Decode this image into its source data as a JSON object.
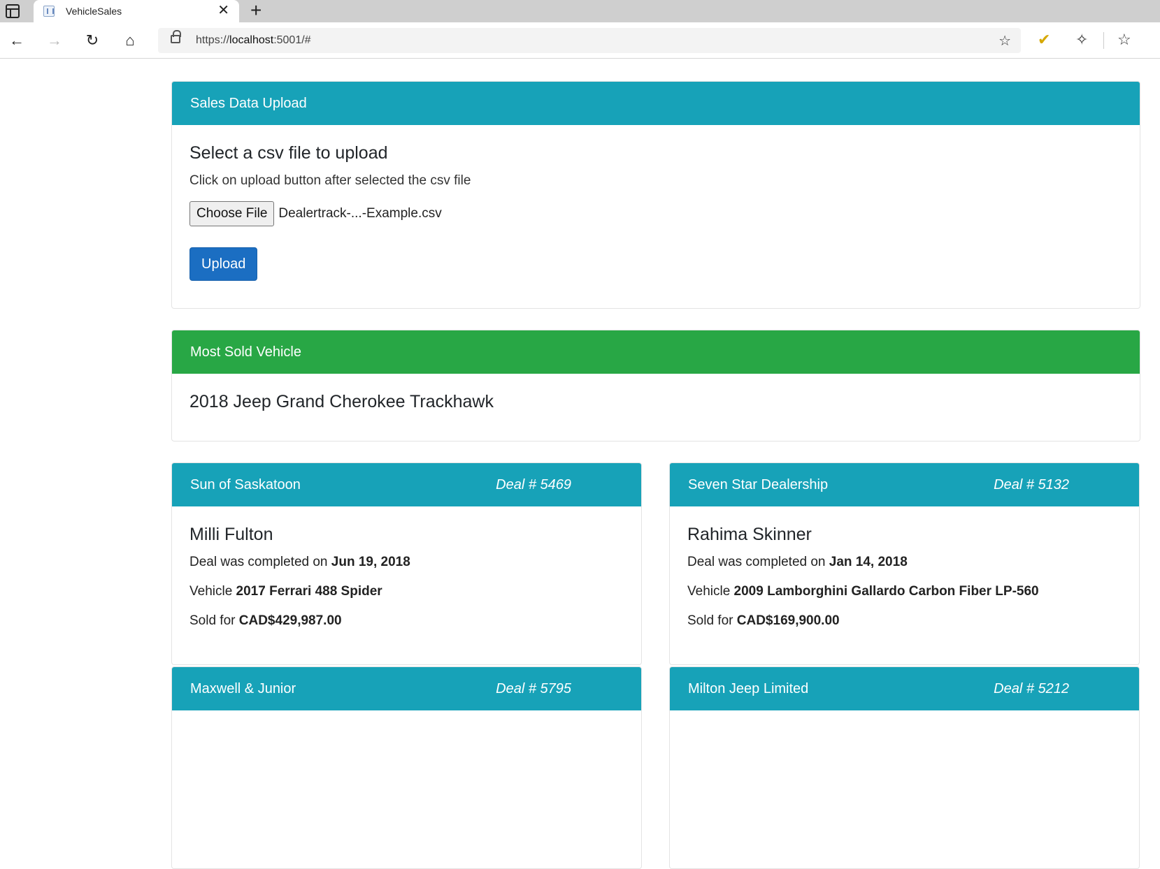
{
  "browser": {
    "tab_title": "VehicleSales",
    "url_prefix": "https://",
    "url_host": "localhost",
    "url_rest": ":5001/#"
  },
  "upload": {
    "header": "Sales Data Upload",
    "title": "Select a csv file to upload",
    "subtitle": "Click on upload button after selected the csv file",
    "choose_label": "Choose File",
    "file_name": "Dealertrack-...-Example.csv",
    "upload_label": "Upload"
  },
  "most_sold": {
    "header": "Most Sold Vehicle",
    "vehicle": "2018 Jeep Grand Cherokee Trackhawk"
  },
  "labels": {
    "completed": "Deal was completed on ",
    "vehicle": "Vehicle ",
    "sold_for": "Sold for "
  },
  "deals": [
    {
      "dealer": "Sun of Saskatoon",
      "deal_number": "Deal # 5469",
      "customer": "Milli Fulton",
      "date": "Jun 19, 2018",
      "vehicle": "2017 Ferrari 488 Spider",
      "price": "CAD$429,987.00"
    },
    {
      "dealer": "Seven Star Dealership",
      "deal_number": "Deal # 5132",
      "customer": "Rahima Skinner",
      "date": "Jan 14, 2018",
      "vehicle": "2009 Lamborghini Gallardo Carbon Fiber LP-560",
      "price": "CAD$169,900.00"
    },
    {
      "dealer": "Maxwell & Junior",
      "deal_number": "Deal # 5795"
    },
    {
      "dealer": "Milton Jeep Limited",
      "deal_number": "Deal # 5212"
    }
  ]
}
